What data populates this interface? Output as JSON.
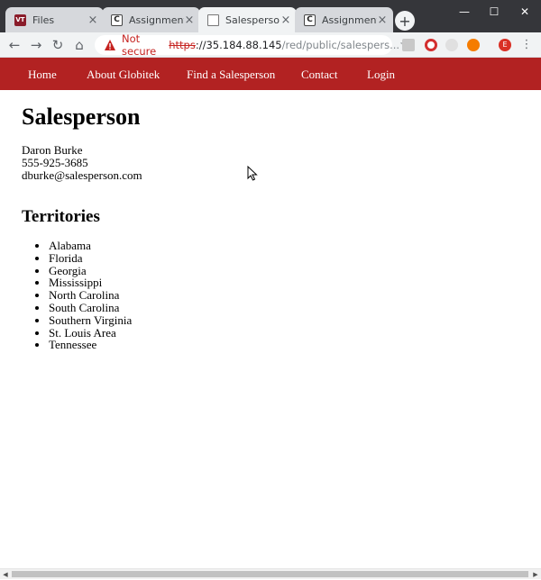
{
  "browser": {
    "tabs": [
      {
        "title": "Files",
        "favicon": "files-icon"
      },
      {
        "title": "Assignment: W",
        "favicon": "canvas-icon"
      },
      {
        "title": "Salesperson: D",
        "favicon": "document-icon"
      },
      {
        "title": "Assignment: W",
        "favicon": "canvas-icon"
      }
    ],
    "address": {
      "security_label": "Not secure",
      "scheme": "https",
      "host": "://35.184.88.145",
      "path": "/red/public/salespers..."
    },
    "profile_initial": "E"
  },
  "site_nav": {
    "items": [
      {
        "label": "Home"
      },
      {
        "label": "About Globitek"
      },
      {
        "label": "Find a Salesperson"
      },
      {
        "label": "Contact"
      },
      {
        "label": "Login"
      }
    ],
    "color": "#b22222"
  },
  "page": {
    "title": "Salesperson",
    "contact": {
      "name": "Daron Burke",
      "phone": "555-925-3685",
      "email": "dburke@salesperson.com"
    },
    "territories_heading": "Territories",
    "territories": [
      "Alabama",
      "Florida",
      "Georgia",
      "Mississippi",
      "North Carolina",
      "South Carolina",
      "Southern Virginia",
      "St. Louis Area",
      "Tennessee"
    ]
  }
}
